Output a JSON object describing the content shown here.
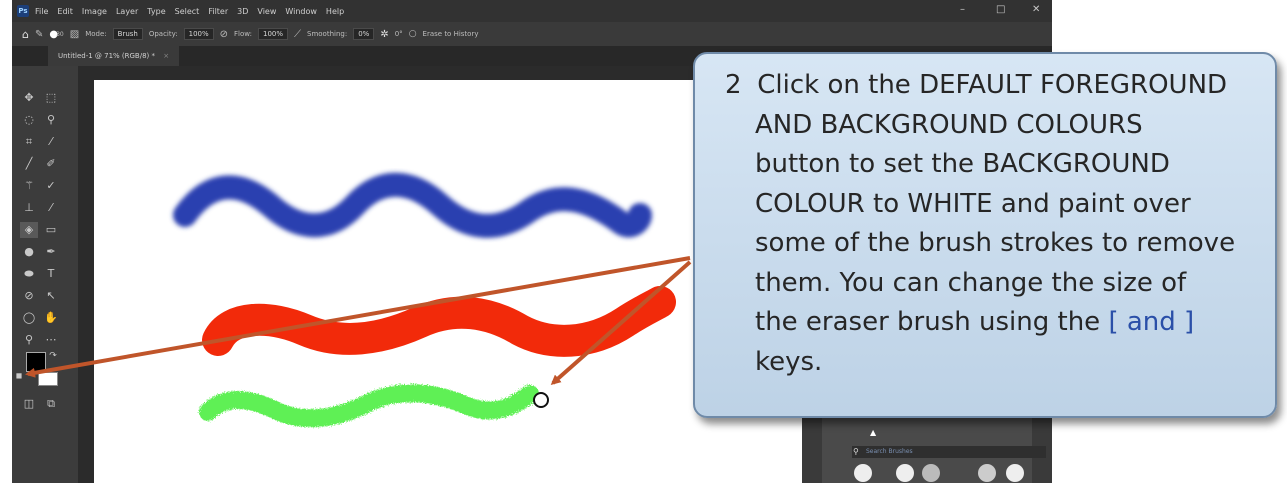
{
  "menubar": {
    "logo": "Ps",
    "items": [
      "File",
      "Edit",
      "Image",
      "Layer",
      "Type",
      "Select",
      "Filter",
      "3D",
      "View",
      "Window",
      "Help"
    ],
    "minimize": "–",
    "restore": "□",
    "close": "✕"
  },
  "options_bar": {
    "mode_label": "Mode:",
    "mode_value": "Brush",
    "opacity_label": "Opacity:",
    "opacity_value": "100%",
    "flow_label": "Flow:",
    "flow_value": "100%",
    "smoothing_label": "Smoothing:",
    "smoothing_value": "0%",
    "angle_value": "0°",
    "erase_history": "Erase to History",
    "brush_size": "30"
  },
  "document_tab": {
    "title": "Untitled-1 @ 71% (RGB/8) *",
    "close": "×"
  },
  "brushes_panel": {
    "search_placeholder": "Search Brushes"
  },
  "callout": {
    "step_number": "2",
    "line1": "Click on the DEFAULT FOREGROUND",
    "line2": "AND BACKGROUND COLOURS",
    "line3": "button to set the BACKGROUND",
    "line4": "COLOUR to WHITE and paint over",
    "line5": "some of the brush strokes to remove",
    "line6": "them.  You can change the size of",
    "line7_pre": "the eraser brush using the ",
    "line7_keys": "[ and ]",
    "line8": "keys."
  },
  "colors": {
    "blue_stroke": "#2a3fb0",
    "red_stroke": "#f22a0a",
    "green_stroke": "#5ef054",
    "arrow": "#c0552a",
    "callout_fill": "#cfe0f0"
  }
}
